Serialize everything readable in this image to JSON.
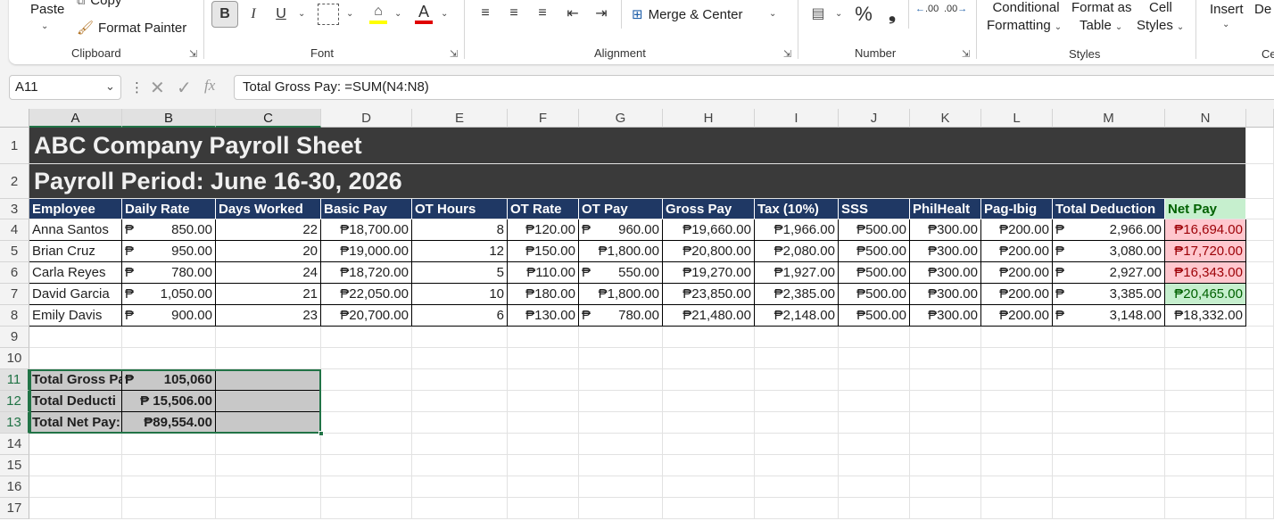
{
  "ribbon": {
    "clipboard": {
      "paste": "Paste",
      "copy": "Copy",
      "format_painter": "Format Painter",
      "title": "Clipboard"
    },
    "font": {
      "bold": "B",
      "italic": "I",
      "underline": "U",
      "font_color_letter": "A",
      "title": "Font"
    },
    "alignment": {
      "merge_center": "Merge & Center",
      "title": "Alignment"
    },
    "number": {
      "percent": "%",
      "comma": "❟",
      "increase_decimal": ".00",
      "decrease_decimal": ".00",
      "title": "Number"
    },
    "styles": {
      "conditional_1": "Conditional",
      "conditional_2": "Formatting",
      "format_table_1": "Format as",
      "format_table_2": "Table",
      "cell_styles_1": "Cell",
      "cell_styles_2": "Styles",
      "title": "Styles"
    },
    "cells": {
      "insert": "Insert",
      "delete_partial": "De",
      "title_partial": "Ce"
    }
  },
  "formula_bar": {
    "name_box": "A11",
    "fx": "fx",
    "formula": "Total Gross Pay: =SUM(N4:N8)"
  },
  "columns": [
    "A",
    "B",
    "C",
    "D",
    "E",
    "F",
    "G",
    "H",
    "I",
    "J",
    "K",
    "L",
    "M",
    "N"
  ],
  "rows": [
    "1",
    "2",
    "3",
    "4",
    "5",
    "6",
    "7",
    "8",
    "9",
    "10",
    "11",
    "12",
    "13",
    "14",
    "15",
    "16",
    "17"
  ],
  "sheet": {
    "title": "ABC Company Payroll Sheet",
    "period": "Payroll Period: June 16-30, 2026",
    "headers": [
      "Employee",
      "Daily Rate",
      "Days Worked",
      "Basic Pay",
      "OT Hours",
      "OT Rate",
      "OT Pay",
      "Gross Pay",
      "Tax (10%)",
      "SSS",
      "PhilHealt",
      "Pag-Ibig",
      "Total Deduction",
      "Net Pay"
    ],
    "currency": "₱",
    "employees": [
      {
        "name": "Anna Santos",
        "daily_rate": "850.00",
        "days": "22",
        "basic": "₱18,700.00",
        "ot_hours": "8",
        "ot_rate": "₱120.00",
        "ot_pay": "960.00",
        "gross": "₱19,660.00",
        "tax": "₱1,966.00",
        "sss": "₱500.00",
        "philhealth": "₱300.00",
        "pagibig": "₱200.00",
        "total_ded": "2,966.00",
        "net": "₱16,694.00",
        "net_status": "neg"
      },
      {
        "name": "Brian Cruz",
        "daily_rate": "950.00",
        "days": "20",
        "basic": "₱19,000.00",
        "ot_hours": "12",
        "ot_rate": "₱150.00",
        "ot_pay": "₱1,800.00",
        "gross": "₱20,800.00",
        "tax": "₱2,080.00",
        "sss": "₱500.00",
        "philhealth": "₱300.00",
        "pagibig": "₱200.00",
        "total_ded": "3,080.00",
        "net": "₱17,720.00",
        "net_status": "neg"
      },
      {
        "name": "Carla Reyes",
        "daily_rate": "780.00",
        "days": "24",
        "basic": "₱18,720.00",
        "ot_hours": "5",
        "ot_rate": "₱110.00",
        "ot_pay": "550.00",
        "gross": "₱19,270.00",
        "tax": "₱1,927.00",
        "sss": "₱500.00",
        "philhealth": "₱300.00",
        "pagibig": "₱200.00",
        "total_ded": "2,927.00",
        "net": "₱16,343.00",
        "net_status": "neg"
      },
      {
        "name": "David Garcia",
        "daily_rate": "1,050.00",
        "days": "21",
        "basic": "₱22,050.00",
        "ot_hours": "10",
        "ot_rate": "₱180.00",
        "ot_pay": "₱1,800.00",
        "gross": "₱23,850.00",
        "tax": "₱2,385.00",
        "sss": "₱500.00",
        "philhealth": "₱300.00",
        "pagibig": "₱200.00",
        "total_ded": "3,385.00",
        "net": "₱20,465.00",
        "net_status": "pos"
      },
      {
        "name": "Emily Davis",
        "daily_rate": "900.00",
        "days": "23",
        "basic": "₱20,700.00",
        "ot_hours": "6",
        "ot_rate": "₱130.00",
        "ot_pay": "780.00",
        "gross": "₱21,480.00",
        "tax": "₱2,148.00",
        "sss": "₱500.00",
        "philhealth": "₱300.00",
        "pagibig": "₱200.00",
        "total_ded": "3,148.00",
        "net": "₱18,332.00",
        "net_status": "none"
      }
    ],
    "totals": [
      {
        "label": "Total Gross Pa",
        "value": "105,060",
        "peso": true
      },
      {
        "label": "Total Deducti",
        "value": "₱ 15,506.00",
        "peso": false
      },
      {
        "label": "Total Net Pay:",
        "value": "₱89,554.00",
        "peso": false
      }
    ]
  },
  "colors": {
    "header_navy": "#1f3864",
    "title_dark": "#3a3a3a",
    "bad_fill": "#ffc7ce",
    "good_fill": "#c6efce",
    "excel_green": "#217346"
  }
}
